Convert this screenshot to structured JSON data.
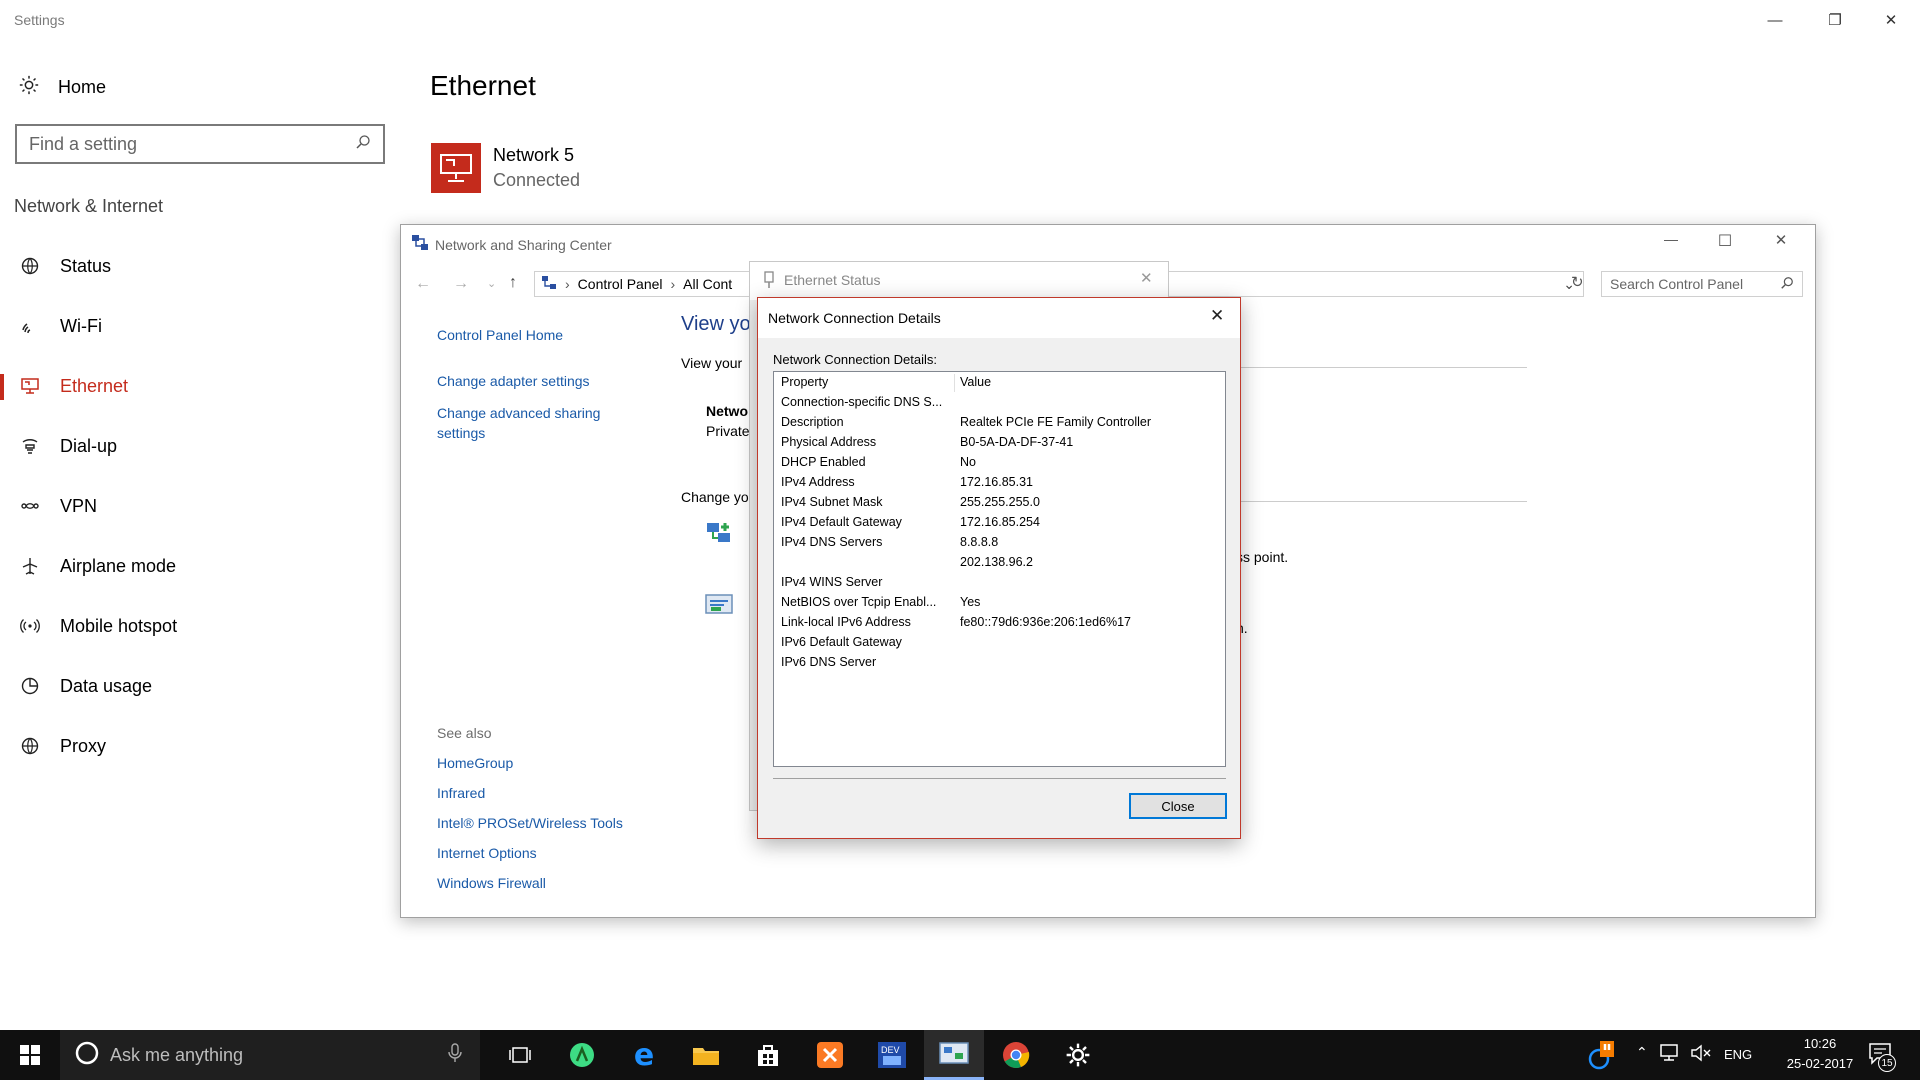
{
  "settings": {
    "window_title": "Settings",
    "home_label": "Home",
    "search_placeholder": "Find a setting",
    "section_label": "Network & Internet",
    "nav": [
      {
        "label": "Status",
        "icon": "globe-status-icon"
      },
      {
        "label": "Wi-Fi",
        "icon": "wifi-icon"
      },
      {
        "label": "Ethernet",
        "icon": "ethernet-icon",
        "active": true
      },
      {
        "label": "Dial-up",
        "icon": "dialup-icon"
      },
      {
        "label": "VPN",
        "icon": "vpn-icon"
      },
      {
        "label": "Airplane mode",
        "icon": "airplane-icon"
      },
      {
        "label": "Mobile hotspot",
        "icon": "hotspot-icon"
      },
      {
        "label": "Data usage",
        "icon": "data-usage-icon"
      },
      {
        "label": "Proxy",
        "icon": "globe-icon"
      }
    ],
    "page_title": "Ethernet",
    "network_name": "Network  5",
    "network_status": "Connected",
    "accent_color": "#c42b1c"
  },
  "nsc": {
    "window_title": "Network and Sharing Center",
    "breadcrumb": [
      "Control Panel",
      "All Cont"
    ],
    "search_placeholder": "Search Control Panel",
    "left_links": [
      "Control Panel Home",
      "Change adapter settings",
      "Change advanced sharing settings"
    ],
    "see_also_label": "See also",
    "see_also": [
      "HomeGroup",
      "Infrared",
      "Intel® PROSet/Wireless Tools",
      "Internet Options",
      "Windows Firewall"
    ],
    "heading_fragment": "View yo",
    "view_your_fragment": "View your",
    "network_fragment": "Netwo",
    "private_fragment": "Private",
    "change_fragment": "Change yo",
    "access_point_fragment": "ss point.",
    "n_fragment": "n."
  },
  "ethernet_status": {
    "title": "Ethernet Status"
  },
  "details": {
    "title": "Network Connection Details",
    "label": "Network Connection Details:",
    "col_property": "Property",
    "col_value": "Value",
    "rows": [
      {
        "p": "Connection-specific DNS S...",
        "v": ""
      },
      {
        "p": "Description",
        "v": "Realtek PCIe FE Family Controller"
      },
      {
        "p": "Physical Address",
        "v": "B0-5A-DA-DF-37-41"
      },
      {
        "p": "DHCP Enabled",
        "v": "No"
      },
      {
        "p": "IPv4 Address",
        "v": "172.16.85.31"
      },
      {
        "p": "IPv4 Subnet Mask",
        "v": "255.255.255.0"
      },
      {
        "p": "IPv4 Default Gateway",
        "v": "172.16.85.254"
      },
      {
        "p": "IPv4 DNS Servers",
        "v": "8.8.8.8"
      },
      {
        "p": "",
        "v": "202.138.96.2"
      },
      {
        "p": "IPv4 WINS Server",
        "v": ""
      },
      {
        "p": "NetBIOS over Tcpip Enabl...",
        "v": "Yes"
      },
      {
        "p": "Link-local IPv6 Address",
        "v": "fe80::79d6:936e:206:1ed6%17"
      },
      {
        "p": "IPv6 Default Gateway",
        "v": ""
      },
      {
        "p": "IPv6 DNS Server",
        "v": ""
      }
    ],
    "close_label": "Close"
  },
  "taskbar": {
    "search_placeholder": "Ask me anything",
    "apps": [
      "task-view-icon",
      "android-studio-icon",
      "edge-icon",
      "file-explorer-icon",
      "store-icon",
      "xampp-icon",
      "devcpp-icon",
      "control-panel-icon",
      "chrome-icon",
      "settings-gear-icon"
    ],
    "language": "ENG",
    "time": "10:26",
    "date": "25-02-2017",
    "notification_count": "15"
  }
}
